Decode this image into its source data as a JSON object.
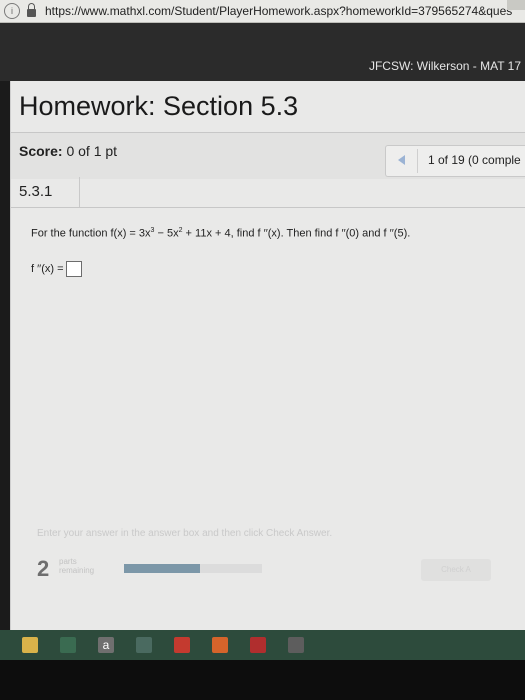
{
  "browser": {
    "url": "https://www.mathxl.com/Student/PlayerHomework.aspx?homeworkId=379565274&ques"
  },
  "header": {
    "course": "JFCSW: Wilkerson - MAT 17"
  },
  "homework": {
    "title": "Homework: Section 5.3",
    "score_label": "Score:",
    "score_value": "0 of 1 pt",
    "progress_text": "1 of 19 (0 comple"
  },
  "question": {
    "id": "5.3.1",
    "text_prefix": "For the function f(x) = 3x",
    "exp1": "3",
    "text_mid1": " − 5x",
    "exp2": "2",
    "text_suffix": " + 11x + 4, find f ′′(x). Then find f ′′(0) and f ′′(5).",
    "answer_label": "f ′′(x) ="
  },
  "footer": {
    "hint": "Enter your answer in the answer box and then click Check Answer.",
    "parts_count": "2",
    "parts_word1": "parts",
    "parts_word2": "remaining",
    "parts_progress": 0.55,
    "check_label": "Check A"
  },
  "taskbar": {
    "icons": [
      "file-explorer-icon",
      "store-icon",
      "amazon-icon",
      "mail-icon",
      "movie-icon",
      "office-icon",
      "red-app-icon",
      "gray-app-icon"
    ],
    "amazon_glyph": "a"
  }
}
